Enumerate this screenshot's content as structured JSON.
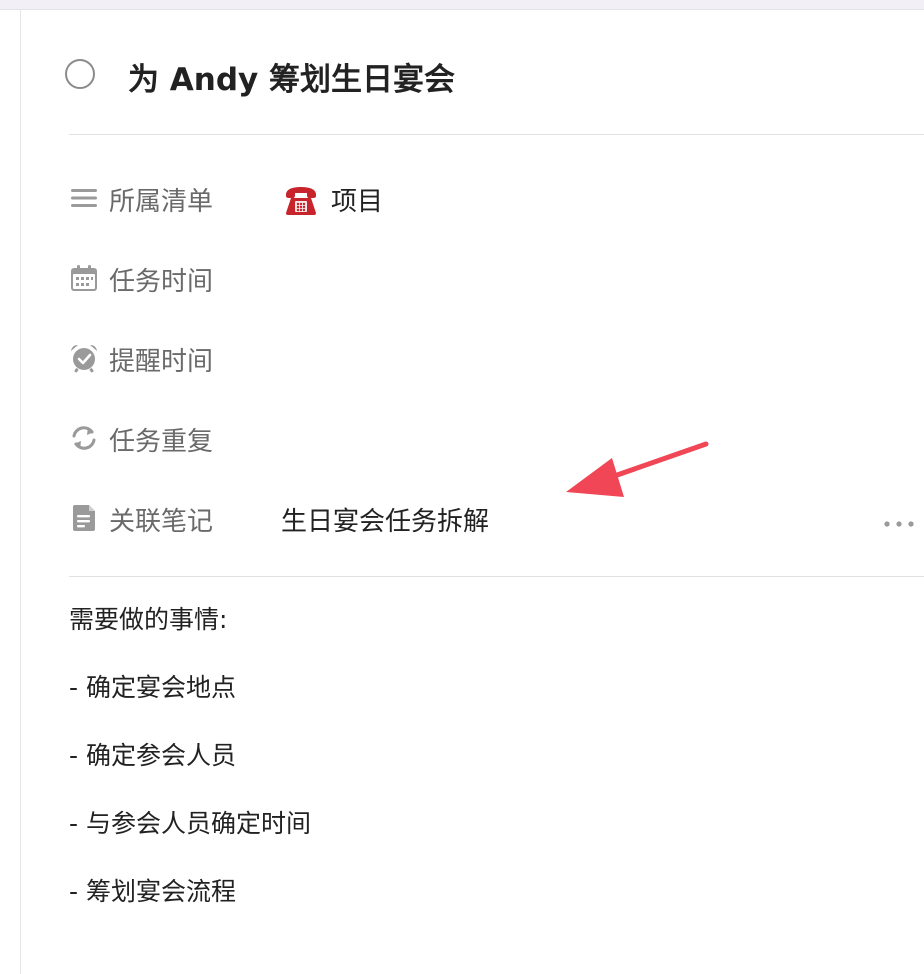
{
  "task": {
    "title": "为 Andy 筹划生日宴会"
  },
  "attributes": {
    "list": {
      "label": "所属清单",
      "value": "项目",
      "value_icon": "telephone-icon"
    },
    "task_time": {
      "label": "任务时间"
    },
    "reminder": {
      "label": "提醒时间"
    },
    "repeat": {
      "label": "任务重复"
    },
    "linked_note": {
      "label": "关联笔记",
      "value": "生日宴会任务拆解"
    }
  },
  "notes": {
    "heading": "需要做的事情:",
    "lines": [
      "- 确定宴会地点",
      "- 确定参会人员",
      "- 与参会人员确定时间",
      "- 筹划宴会流程"
    ]
  },
  "icons": {
    "list": "list-icon",
    "task_time": "calendar-icon",
    "reminder": "alarm-clock-icon",
    "repeat": "repeat-icon",
    "linked_note": "note-icon",
    "more": "more-icon"
  },
  "colors": {
    "annotation_arrow": "#f04655",
    "icon_gray": "#9a9a9a",
    "telephone_red": "#c8242c"
  }
}
